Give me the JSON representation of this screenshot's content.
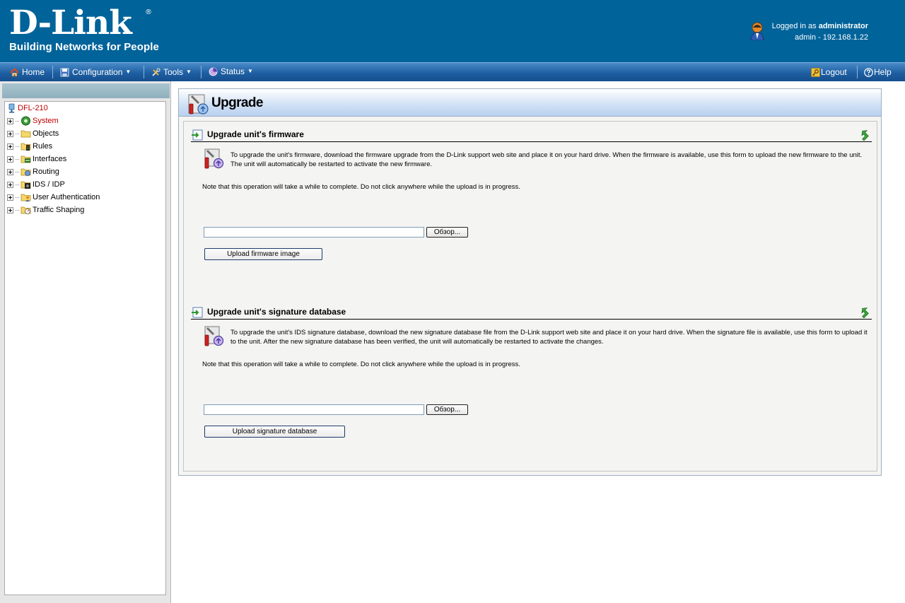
{
  "header": {
    "logo_text": "D-Link",
    "logo_registered": "®",
    "logo_tagline": "Building Networks for People",
    "logged_in_prefix": "Logged in as ",
    "logged_in_user": "administrator",
    "session_info": "admin - 192.168.1.22"
  },
  "menu": {
    "home": "Home",
    "configuration": "Configuration",
    "tools": "Tools",
    "status": "Status",
    "logout": "Logout",
    "help": "Help",
    "dropdown_arrow": "▼"
  },
  "tree": {
    "root": "DFL-210",
    "items": [
      {
        "label": "System",
        "icon": "gear-icon"
      },
      {
        "label": "Objects",
        "icon": "folder-icon"
      },
      {
        "label": "Rules",
        "icon": "rules-icon"
      },
      {
        "label": "Interfaces",
        "icon": "interfaces-icon"
      },
      {
        "label": "Routing",
        "icon": "routing-icon"
      },
      {
        "label": "IDS / IDP",
        "icon": "ids-icon"
      },
      {
        "label": "User Authentication",
        "icon": "user-auth-icon"
      },
      {
        "label": "Traffic Shaping",
        "icon": "traffic-shaping-icon"
      }
    ]
  },
  "page": {
    "title": "Upgrade"
  },
  "sections": {
    "firmware": {
      "title": "Upgrade unit's firmware",
      "description": "To upgrade the unit's firmware, download the firmware upgrade from the D-Link support web site and place it on your hard drive. When the firmware is available, use this form to upload the new firmware to the unit. The unit will automatically be restarted to activate the new firmware.",
      "note": "Note that this operation will take a while to complete. Do not click anywhere while the upload is in progress.",
      "file_value": "",
      "browse_label": "Обзор...",
      "upload_label": "Upload firmware image"
    },
    "signature": {
      "title": "Upgrade unit's signature database",
      "description": "To upgrade the unit's IDS signature database, download the new signature database file from the D-Link support web site and place it on your hard drive. When the signature file is available, use this form to upload it to the unit. After the new signature database has been verified, the unit will automatically be restarted to activate the changes.",
      "note": "Note that this operation will take a while to complete. Do not click anywhere while the upload is in progress.",
      "file_value": "",
      "browse_label": "Обзор...",
      "upload_label": "Upload signature database"
    }
  },
  "colors": {
    "header_bg": "#00639a",
    "menubar_bg": "#1e5fa2",
    "tree_selected": "#c00000"
  }
}
